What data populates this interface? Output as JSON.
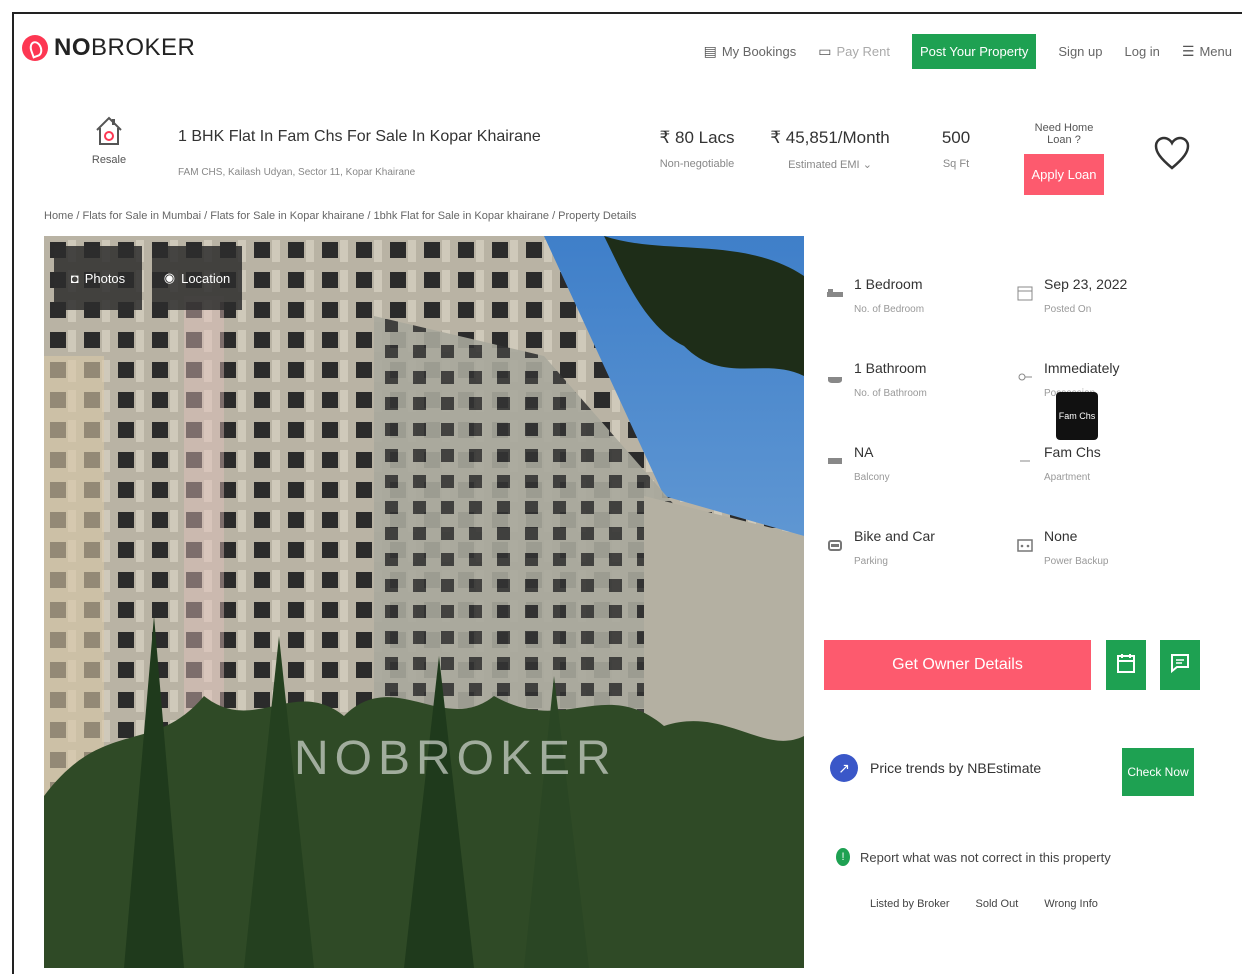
{
  "header": {
    "logo": {
      "bold": "NO",
      "rest": "BROKER"
    },
    "nav": {
      "bookings": "My Bookings",
      "pay_rent": "Pay Rent",
      "post_property": "Post Your Property",
      "sign_up": "Sign up",
      "log_in": "Log in",
      "menu": "Menu"
    }
  },
  "listing": {
    "type_label": "Resale",
    "title": "1 BHK Flat In Fam Chs For Sale In Kopar Khairane",
    "address": "FAM CHS, Kailash Udyan, Sector 11, Kopar Khairane",
    "price": "₹ 80 Lacs",
    "price_label": "Non-negotiable",
    "emi": "₹ 45,851/Month",
    "emi_label": "Estimated EMI",
    "area": "500",
    "area_label": "Sq Ft",
    "loan_question": "Need Home Loan ?",
    "loan_button": "Apply Loan"
  },
  "breadcrumb": "Home / Flats for Sale in Mumbai / Flats for Sale in Kopar khairane / 1bhk Flat for Sale in Kopar khairane / Property Details",
  "photo": {
    "photos_button": "Photos",
    "location_button": "Location",
    "watermark": "NOBROKER"
  },
  "details": [
    {
      "value": "1 Bedroom",
      "label": "No. of Bedroom",
      "icon": "bed-icon"
    },
    {
      "value": "Sep 23, 2022",
      "label": "Posted On",
      "icon": "calendar-icon"
    },
    {
      "value": "1 Bathroom",
      "label": "No. of Bathroom",
      "icon": "bath-icon"
    },
    {
      "value": "Immediately",
      "label": "Possession",
      "icon": "key-icon"
    },
    {
      "value": "NA",
      "label": "Balcony",
      "icon": "balcony-icon"
    },
    {
      "value": "Fam Chs",
      "label": "Apartment",
      "icon": "building-icon"
    },
    {
      "value": "Bike and Car",
      "label": "Parking",
      "icon": "car-icon"
    },
    {
      "value": "None",
      "label": "Power Backup",
      "icon": "battery-icon"
    }
  ],
  "tooltip": "Fam Chs",
  "actions": {
    "owner_button": "Get Owner Details",
    "price_trends": "Price trends by NBEstimate",
    "check_now": "Check Now",
    "report_text": "Report what was not correct in this property",
    "report_links": [
      "Listed by Broker",
      "Sold Out",
      "Wrong Info"
    ]
  },
  "colors": {
    "brand": "#fd3752",
    "green": "#1ea152",
    "pink_button": "#fd5a6e",
    "trend_icon": "#3a57c8"
  }
}
